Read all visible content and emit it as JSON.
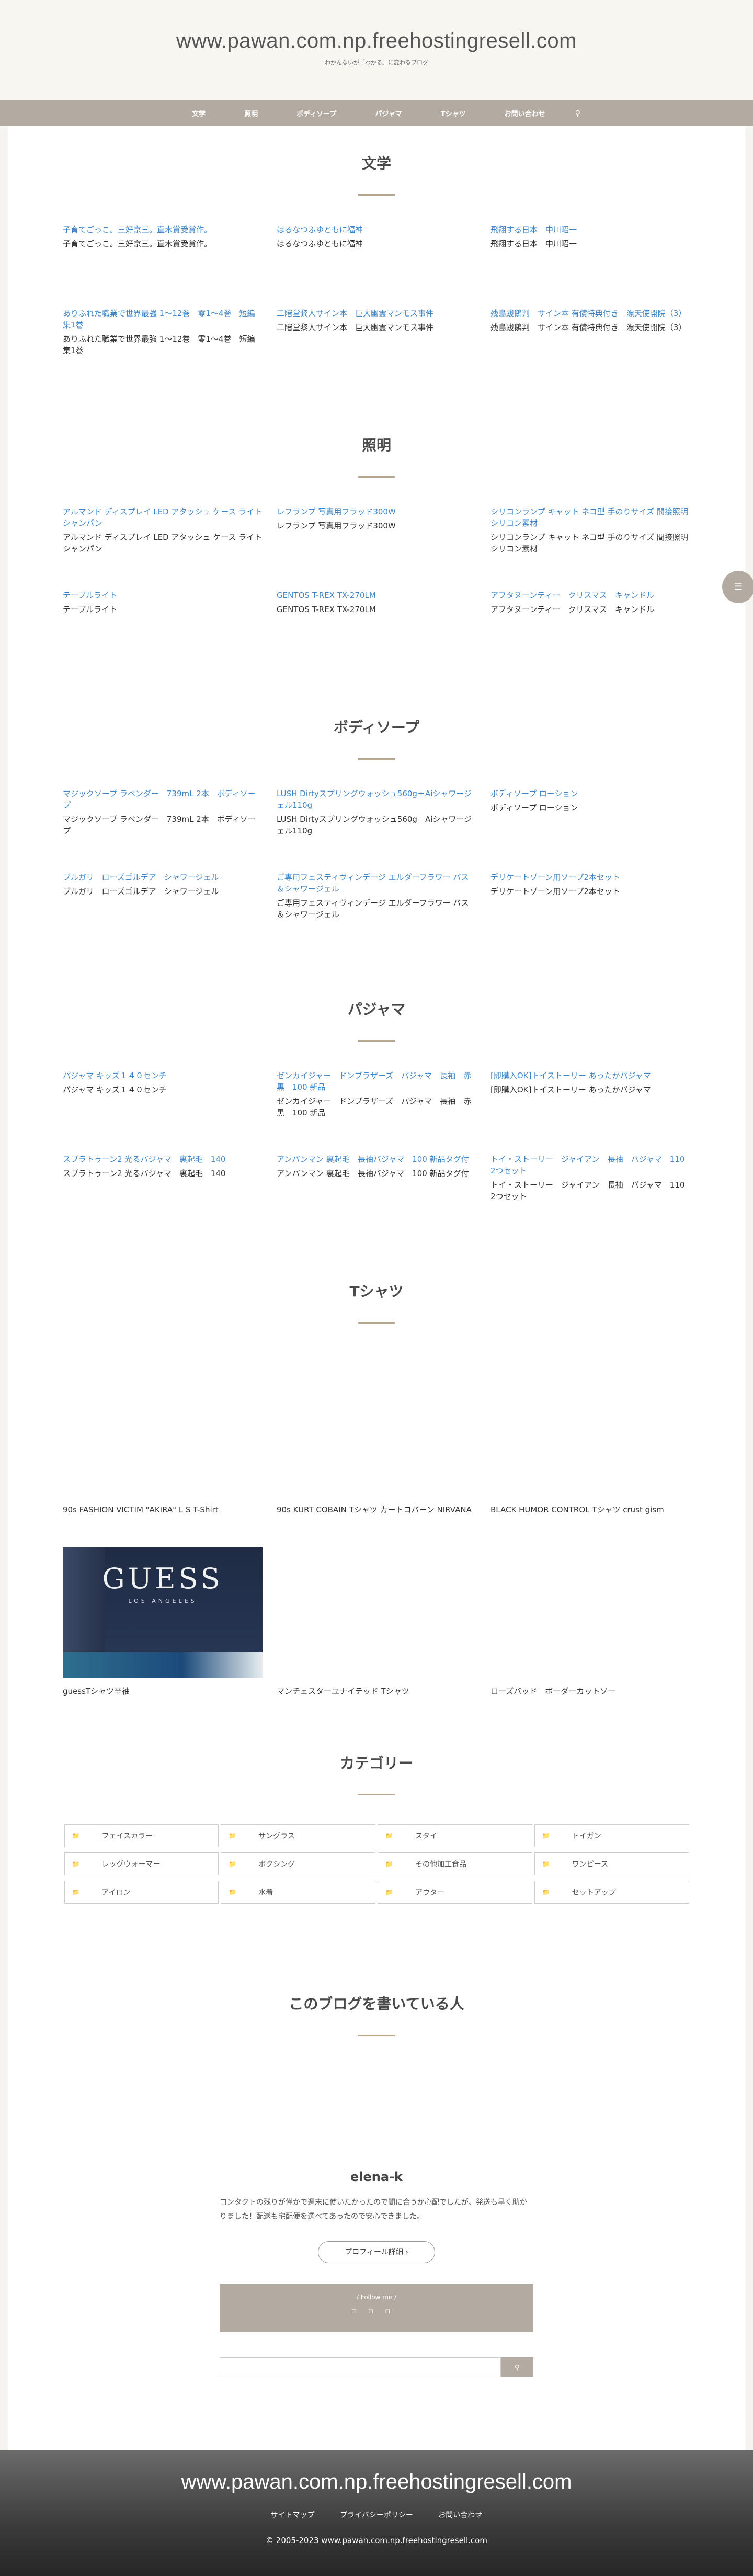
{
  "header": {
    "title": "www.pawan.com.np.freehostingresell.com",
    "tagline": "わかんないが「わかる」に変わるブログ"
  },
  "nav": {
    "items": [
      "文学",
      "照明",
      "ボディソープ",
      "パジャマ",
      "Tシャツ",
      "お問い合わせ"
    ],
    "search_icon": "search-icon"
  },
  "sections": {
    "bungaku": {
      "title": "文学",
      "items": [
        {
          "alt": "子育てごっこ。三好京三。直木賞受賞作。",
          "title": "子育てごっこ。三好京三。直木賞受賞作。"
        },
        {
          "alt": "はるなつふゆともに福神",
          "title": "はるなつふゆともに福神"
        },
        {
          "alt": "飛翔する日本　中川昭一",
          "title": "飛翔する日本　中川昭一"
        },
        {
          "alt": "ありふれた職業で世界最強 1〜12巻　零1〜4巻　短編集1巻",
          "title": "ありふれた職業で世界最強 1〜12巻　零1〜4巻　短編集1巻"
        },
        {
          "alt": "二階堂黎人サイン本　巨大幽霊マンモス事件",
          "title": "二階堂黎人サイン本　巨大幽霊マンモス事件"
        },
        {
          "alt": "残島跋鵝判　サイン本 有償特典付き　漂天使開院（3）",
          "title": "残島跋鵝判　サイン本 有償特典付き　漂天使開院（3）"
        }
      ]
    },
    "shoumei": {
      "title": "照明",
      "items": [
        {
          "alt": "アルマンド ディスプレイ LED アタッシュ ケース ライト シャンパン",
          "title": "アルマンド ディスプレイ LED アタッシュ ケース ライト シャンパン"
        },
        {
          "alt": "レフランプ 写真用フラッド300W",
          "title": "レフランプ 写真用フラッド300W"
        },
        {
          "alt": "シリコンランプ キャット ネコ型 手のりサイズ 間接照明 シリコン素材",
          "title": "シリコンランプ キャット ネコ型 手のりサイズ 間接照明 シリコン素材"
        },
        {
          "alt": "テーブルライト",
          "title": "テーブルライト"
        },
        {
          "alt": "GENTOS T-REX TX-270LM",
          "title": "GENTOS T-REX TX-270LM"
        },
        {
          "alt": "アフタヌーンティー　クリスマス　キャンドル",
          "title": "アフタヌーンティー　クリスマス　キャンドル"
        }
      ]
    },
    "soap": {
      "title": "ボディソープ",
      "items": [
        {
          "alt": "マジックソープ ラベンダー　739mL 2本　ボディソープ",
          "title": "マジックソープ ラベンダー　739mL 2本　ボディソープ"
        },
        {
          "alt": "LUSH Dirtyスプリングウォッシュ560g＋Aiシャワージェル110g",
          "title": "LUSH Dirtyスプリングウォッシュ560g＋Aiシャワージェル110g"
        },
        {
          "alt": "ボディソープ ローション",
          "title": "ボディソープ ローション"
        },
        {
          "alt": "ブルガリ　ローズゴルデア　シャワージェル",
          "title": "ブルガリ　ローズゴルデア　シャワージェル"
        },
        {
          "alt": "ご専用フェスティヴィンデージ エルダーフラワー バス ＆シャワージェル",
          "title": "ご専用フェスティヴィンデージ エルダーフラワー バス ＆シャワージェル"
        },
        {
          "alt": "デリケートゾーン用ソープ2本セット",
          "title": "デリケートゾーン用ソープ2本セット"
        }
      ]
    },
    "pajama": {
      "title": "パジャマ",
      "items": [
        {
          "alt": "パジャマ キッズ１４０センチ",
          "title": "パジャマ キッズ１４０センチ"
        },
        {
          "alt": "ゼンカイジャー　ドンブラザーズ　パジャマ　長袖　赤　黒　100 新品",
          "title": "ゼンカイジャー　ドンブラザーズ　パジャマ　長袖　赤　黒　100 新品"
        },
        {
          "alt": "[即購入OK]トイストーリー あったかパジャマ",
          "title": "[即購入OK]トイストーリー あったかパジャマ"
        },
        {
          "alt": "スプラトゥーン2 光るパジャマ　裏起毛　140",
          "title": "スプラトゥーン2 光るパジャマ　裏起毛　140"
        },
        {
          "alt": "アンパンマン 裏起毛　長袖パジャマ　100 新品タグ付",
          "title": "アンパンマン 裏起毛　長袖パジャマ　100 新品タグ付"
        },
        {
          "alt": "トイ・ストーリー　ジャイアン　長袖　パジャマ　110 2つセット",
          "title": "トイ・ストーリー　ジャイアン　長袖　パジャマ　110 2つセット"
        }
      ]
    },
    "tshirt": {
      "title": "Tシャツ",
      "items": [
        {
          "title": "90s FASHION VICTIM \"AKIRA\" L S T-Shirt"
        },
        {
          "title": "90s KURT COBAIN Tシャツ カートコバーン NIRVANA"
        },
        {
          "title": "BLACK HUMOR CONTROL Tシャツ crust gism"
        },
        {
          "title": "guessTシャツ半袖"
        },
        {
          "title": "マンチェスターユナイテッド Tシャツ"
        },
        {
          "title": "ローズバッド　ボーダーカットソー"
        }
      ],
      "guess_logo": "GUESS",
      "guess_sub": "LOS ANGELES"
    }
  },
  "categories": {
    "title": "カテゴリー",
    "items": [
      "フェイスカラー",
      "サングラス",
      "スタイ",
      "トイガン",
      "レッグウォーマー",
      "ボクシング",
      "その他加工食品",
      "ワンピース",
      "アイロン",
      "水着",
      "アウター",
      "セットアップ"
    ]
  },
  "profile": {
    "heading": "このブログを書いている人",
    "name": "elena-k",
    "description": "コンタクトの残りが僅かで週末に使いたかったので間に合うか心配でしたが、発送も早く助かりました！配送も宅配便を選べてあったので安心できました。",
    "button": "プロフィール詳細 ›",
    "follow_label": "/ Follow me /",
    "follow_icons": "   ",
    "search_placeholder": "",
    "search_button": ""
  },
  "footer": {
    "title": "www.pawan.com.np.freehostingresell.com",
    "links": [
      "サイトマップ",
      "プライバシーポリシー",
      "お問い合わせ"
    ],
    "copyright": "© 2005-2023 www.pawan.com.np.freehostingresell.com"
  },
  "colors": {
    "accent": "#b3aba1",
    "title_bar": "#b8a58a",
    "link": "#3e86c7"
  }
}
